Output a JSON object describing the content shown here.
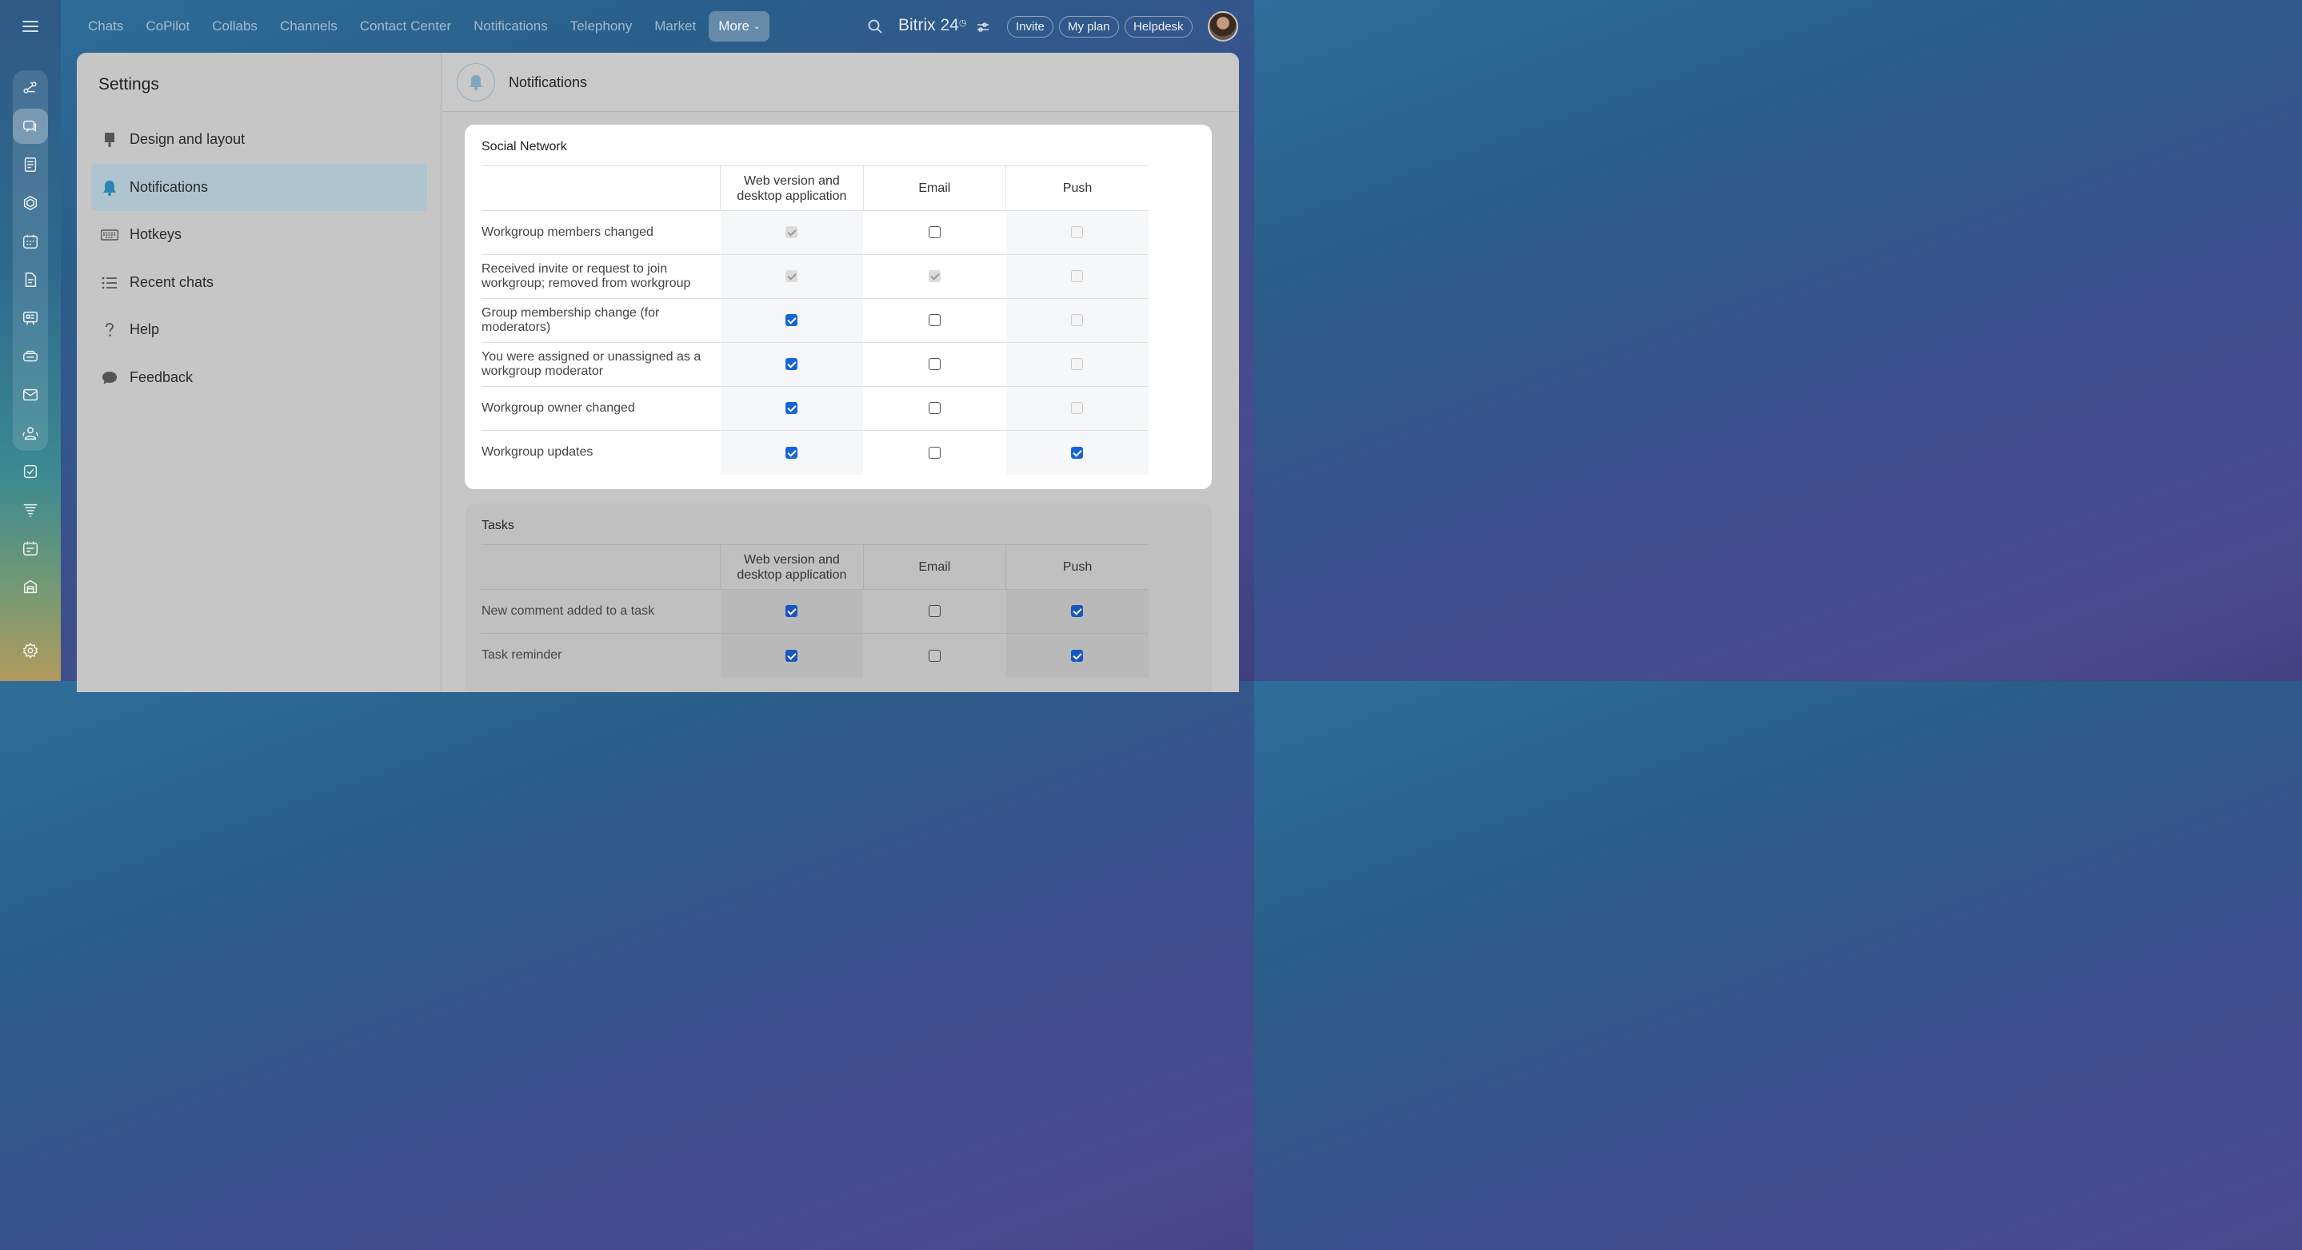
{
  "topnav": {
    "tabs": [
      "Chats",
      "CoPilot",
      "Collabs",
      "Channels",
      "Contact Center",
      "Notifications",
      "Telephony",
      "Market"
    ],
    "more_label": "More"
  },
  "header": {
    "brand": "Bitrix 24",
    "invite": "Invite",
    "my_plan": "My plan",
    "helpdesk": "Helpdesk"
  },
  "sidebar": {
    "title": "Settings",
    "items": [
      {
        "label": "Design and layout",
        "icon": "brush-icon"
      },
      {
        "label": "Notifications",
        "icon": "bell-icon",
        "active": true
      },
      {
        "label": "Hotkeys",
        "icon": "keyboard-icon"
      },
      {
        "label": "Recent chats",
        "icon": "list-icon"
      },
      {
        "label": "Help",
        "icon": "question-icon"
      },
      {
        "label": "Feedback",
        "icon": "chat-bubble-icon"
      }
    ]
  },
  "main": {
    "title": "Notifications",
    "columns": [
      "Web version and desktop application",
      "Email",
      "Push"
    ],
    "sections": [
      {
        "title": "Social Network",
        "rows": [
          {
            "label": "Workgroup members changed",
            "web": {
              "checked": true,
              "disabled": true
            },
            "email": {
              "checked": false,
              "disabled": false
            },
            "push": {
              "checked": false,
              "disabled": true
            }
          },
          {
            "label": "Received invite or request to join workgroup; removed from workgroup",
            "web": {
              "checked": true,
              "disabled": true
            },
            "email": {
              "checked": true,
              "disabled": true
            },
            "push": {
              "checked": false,
              "disabled": true
            }
          },
          {
            "label": "Group membership change (for moderators)",
            "web": {
              "checked": true,
              "disabled": false
            },
            "email": {
              "checked": false,
              "disabled": false
            },
            "push": {
              "checked": false,
              "disabled": true
            }
          },
          {
            "label": "You were assigned or unassigned as a workgroup moderator",
            "web": {
              "checked": true,
              "disabled": false
            },
            "email": {
              "checked": false,
              "disabled": false
            },
            "push": {
              "checked": false,
              "disabled": true
            }
          },
          {
            "label": "Workgroup owner changed",
            "web": {
              "checked": true,
              "disabled": false
            },
            "email": {
              "checked": false,
              "disabled": false
            },
            "push": {
              "checked": false,
              "disabled": true
            }
          },
          {
            "label": "Workgroup updates",
            "web": {
              "checked": true,
              "disabled": false
            },
            "email": {
              "checked": false,
              "disabled": false
            },
            "push": {
              "checked": true,
              "disabled": false
            }
          }
        ]
      },
      {
        "title": "Tasks",
        "rows": [
          {
            "label": "New comment added to a task",
            "web": {
              "checked": true,
              "disabled": false
            },
            "email": {
              "checked": false,
              "disabled": false
            },
            "push": {
              "checked": true,
              "disabled": false
            }
          },
          {
            "label": "Task reminder",
            "web": {
              "checked": true,
              "disabled": false
            },
            "email": {
              "checked": false,
              "disabled": false
            },
            "push": {
              "checked": true,
              "disabled": false
            }
          }
        ]
      }
    ]
  }
}
